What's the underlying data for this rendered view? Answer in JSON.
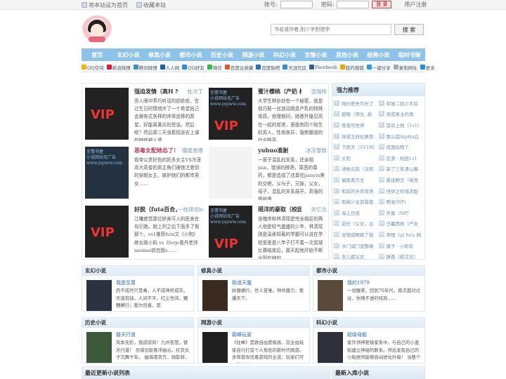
{
  "topbar": {
    "set_home": "将本站设为首页",
    "favorite": "收藏本站",
    "account_label": "账号:",
    "password_label": "密码:",
    "login_button": "登 录",
    "register": "用户注册"
  },
  "search": {
    "placeholder": "书名或作者,别少字别错字",
    "button": "搜 索"
  },
  "nav": [
    "首页",
    "玄幻小说",
    "修真小说",
    "都市小说",
    "历史小说",
    "网游小说",
    "科幻小说",
    "言情小说",
    "其他小说",
    "经典小说",
    "临时书架"
  ],
  "share": [
    "QQ空间",
    "新浪微博",
    "腾讯微博",
    "人人网",
    "QQ好友",
    "微信",
    "百度云收藏",
    "百度贴吧",
    "天涯社区",
    "Facebook",
    "我的搜狐",
    "一键分享",
    "复制网址",
    "更多"
  ],
  "featured": [
    {
      "title": "强迫发情（高H NP）",
      "author": "杜冷丁",
      "desc": "旁人眼中乖巧听话的颜依依，在过生日时情悄许了一个希望自己会被各式各样的帅哥追捧的愿望，好能离黄贞的思谈。然后呢？然后第二天涨着摇涨去上课的她就被人逮……",
      "cover": "vip"
    },
    {
      "title": "蜜汁樱桃（产奶 校园",
      "author": "苦咖啡",
      "desc": "大学生林妙妙有一个秘密，就是很巧娶一丝迷动跟盘产乳的特殊体质。痘理期间，她意外撞见高在一起的邬贤，里面有四个陷生的男人，性格各异，强势霸道的社会精英，……",
      "cover": "vip"
    },
    {
      "title": "恶毒女配她怂了!",
      "author": "猫尾易爆",
      "desc": "假帝公贵好色的奶多女主VS冷漠高大英俊的男主角们被她注意到的穿越女主，嫉妒她们的都市男女……",
      "cover": "wm"
    },
    {
      "title": "yuhuo准耐",
      "author": "冰冻雪糕",
      "desc": "一家子混乱的关系，还亲相jian，错误的醉酒，罪恶的春药，都是造成了违禀伦jianyin爽的交缠。父与子，兄妹，父女，母子，混乱的关系展开，高强的情欲遭……",
      "cover": "light"
    },
    {
      "title": "好脱（futa百合，",
      "author": "一枝遮泡bu",
      "desc": "江曦惑觉那位娇美可人的医舍在勾引她。她上列之后下面多了根那个。vs1推荐futa文《小狗》 继女跟小妈 vs《ferje看丹老师meimei抓包骰s……",
      "cover": "vip"
    },
    {
      "title": "瑶洋的豪取（校园 1v1）",
      "author": "关忆北",
      "desc": "张槐序和林清瑶是完全相反的两人他是轻气盛盛的少年，林清瑶则是温柔知著的学霸可以说在学校里里是八竿子打不着一次篮球比赛结束后，那天起他开始不断出现在她的……",
      "cover": "vip"
    }
  ],
  "rank": {
    "title": "强力推荐",
    "items": [
      {
        "n": "1",
        "t": "翔约丢失可长了"
      },
      {
        "n": "2",
        "t": "和谁二找少手后"
      },
      {
        "n": "3",
        "t": "碧翰（师生, 高"
      },
      {
        "n": "4",
        "t": "穿成男主的鬼"
      },
      {
        "n": "5",
        "t": "苍苍的世界"
      },
      {
        "n": "6",
        "t": "首欢上他（1v1）"
      },
      {
        "n": "7",
        "t": "穿成王府拉粟铁"
      },
      {
        "n": "8",
        "t": "那么甜AlpHa白"
      },
      {
        "n": "9",
        "t": "下雨天（1V1H）"
      },
      {
        "n": "10",
        "t": "双面玩物了"
      },
      {
        "n": "11",
        "t": "太阳"
      },
      {
        "n": "12",
        "t": "恋游 · 校园1v1"
      },
      {
        "n": "13",
        "t": "诱她沦陷（涂鸦"
      },
      {
        "n": "14",
        "t": "装了三年清心寡"
      },
      {
        "n": "15",
        "t": "偏那柔杰生"
      },
      {
        "n": "16",
        "t": "最佳野王（电竞"
      },
      {
        "n": "17",
        "t": "和前的天背背美"
      },
      {
        "n": "18",
        "t": "快穿之珍惜求配"
      },
      {
        "n": "19",
        "t": "熊掉少主前看我"
      },
      {
        "n": "20",
        "t": "野宠(NP)"
      },
      {
        "n": "21",
        "t": "海上日夜"
      },
      {
        "n": "22",
        "t": "开案（NP）"
      },
      {
        "n": "23",
        "t": "前任（父女，古"
      },
      {
        "n": "24",
        "t": "日暮西帆（产女"
      },
      {
        "n": "25",
        "t": "宠物成精赖了我"
      },
      {
        "n": "26",
        "t": "骨哩（gl futa 网"
      },
      {
        "n": "27",
        "t": "水门调门宽整喇"
      },
      {
        "n": "28",
        "t": "属于 · 小妈有"
      },
      {
        "n": "29",
        "t": "女儿妮父女"
      },
      {
        "n": "30",
        "t": "酥香（糙汉文）"
      }
    ]
  },
  "categories": [
    {
      "head": "玄幻小说",
      "title": "我是至尊",
      "body": "药不成丹只是毒，人不成神终成灰。 天道有缺，人间不平，红尘世间，魍魉横行；我尔良善，怒",
      "img": "我是至尊"
    },
    {
      "head": "修真小说",
      "title": "极道天魔",
      "body": "妖魔横行，世人苦难。神兵魔刃，惹爆天下。",
      "img": "极道天魔"
    },
    {
      "head": "都市小说",
      "title": "我的1979",
      "body": "一觉醒来，回到70年代，再次面对过往，你猜不透的结局……",
      "img": "我的1979"
    },
    {
      "head": "历史小说",
      "title": "替天行道",
      "body": "风本无形，我欲驭风！九州苦楚，替天行道！ 吾骑剑斩悬浮幽谷，红衣女子沉舞千年。 幽海港货万，骑影释，",
      "img": "替天行道"
    },
    {
      "head": "网游小说",
      "title": "巅峰玩家",
      "body": "《拄棒》是款自由度极高，完全由玩家自行打造个人角色的新时代网游。 多阵营攻伐悬游戏的主流，玩家们可以影响所",
      "img": "巅峰玩家"
    },
    {
      "head": "科幻小说",
      "title": "超级母舰",
      "body": "星外领神矩级星系中，与自己的小盖船建立神秘的联系。然后发现自己的小船居然能够自动进化升级！ 当整个地球都",
      "img": "超级母舰"
    }
  ],
  "bottom": {
    "left": "最近更新小说列表",
    "right": "最新入库小说"
  },
  "watermark": [
    "言情书屋",
    "小说网站无广告",
    "www.yqzww.com"
  ],
  "colors": {
    "nav": "#8dc3e8",
    "accent": "#2a6db0",
    "login": "#b00000"
  }
}
